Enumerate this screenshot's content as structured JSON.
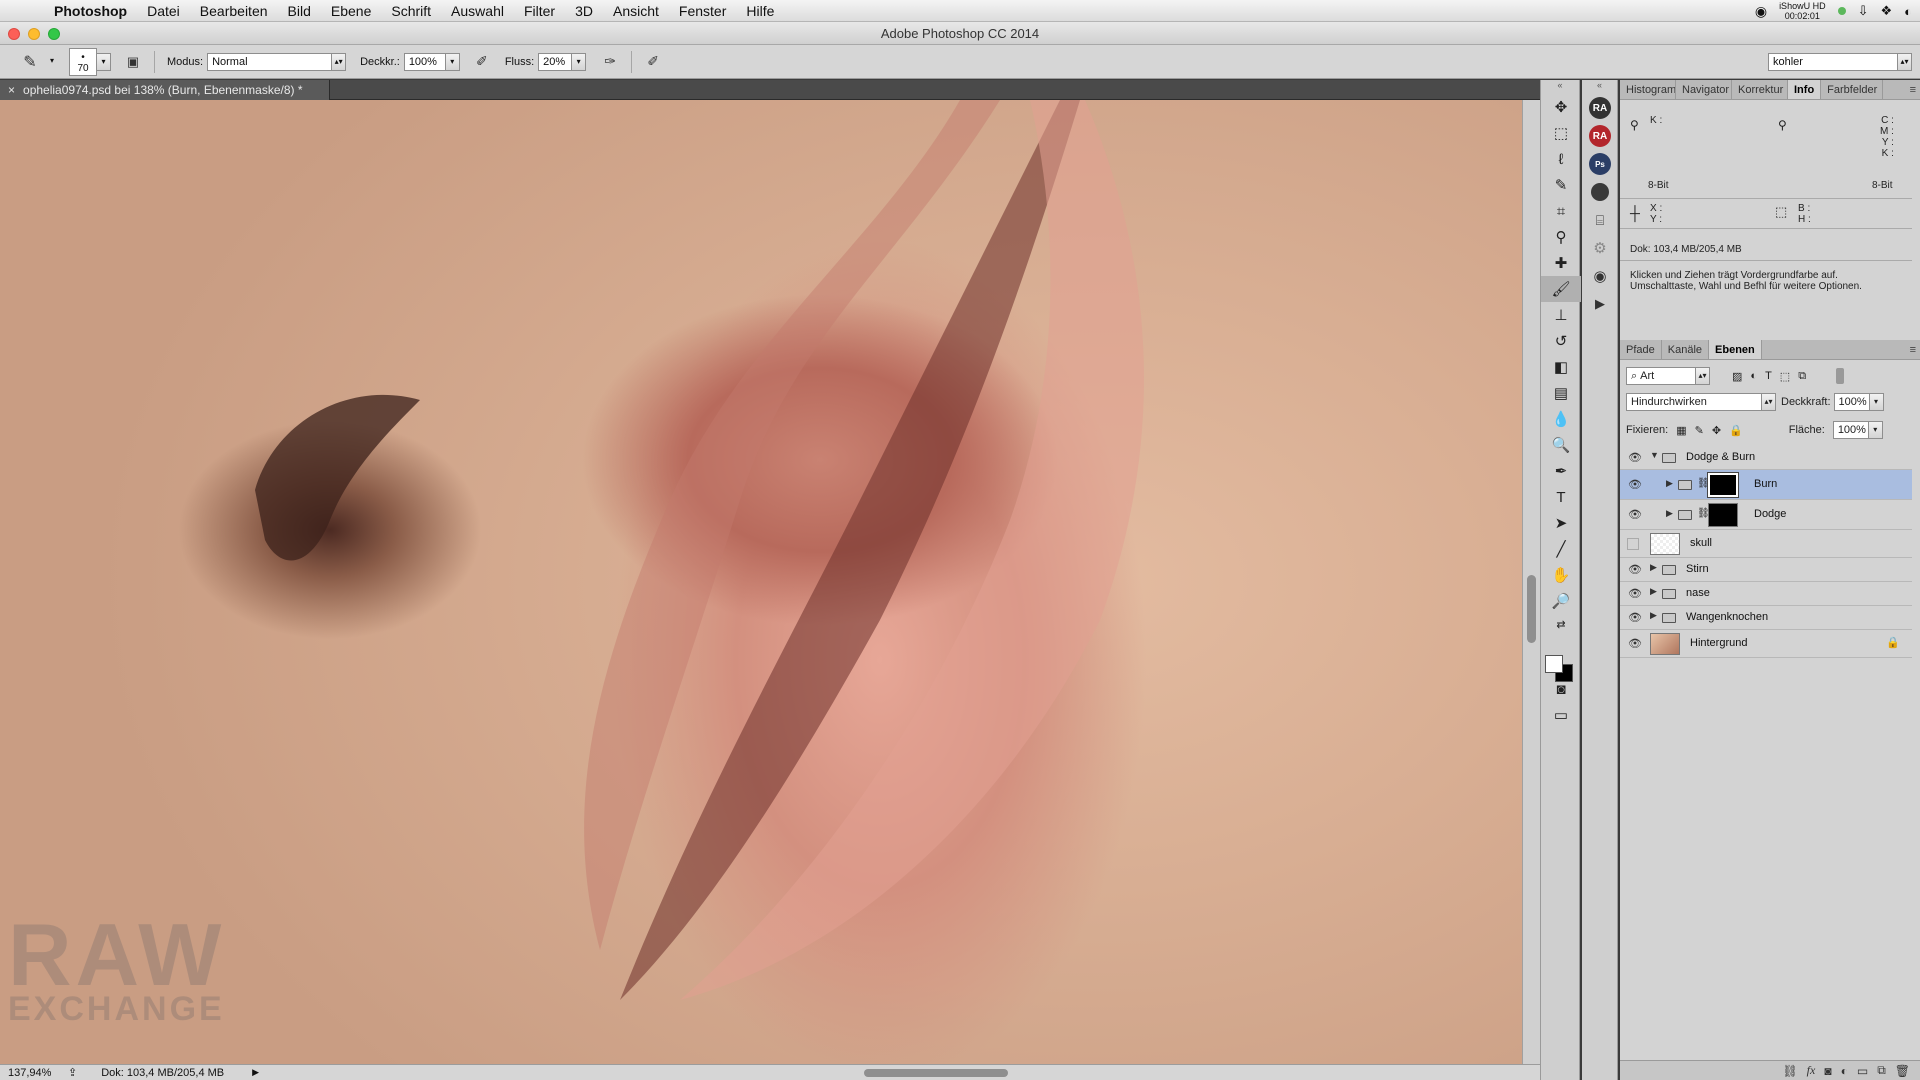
{
  "menubar": {
    "app": "Photoshop",
    "items": [
      "Datei",
      "Bearbeiten",
      "Bild",
      "Ebene",
      "Schrift",
      "Auswahl",
      "Filter",
      "3D",
      "Ansicht",
      "Fenster",
      "Hilfe"
    ],
    "recorder_line1": "iShowU HD",
    "recorder_line2": "00:02:01"
  },
  "window": {
    "title": "Adobe Photoshop CC 2014"
  },
  "options": {
    "brush_size": "70",
    "mode_label": "Modus:",
    "mode_value": "Normal",
    "opacity_label": "Deckkr.:",
    "opacity_value": "100%",
    "flow_label": "Fluss:",
    "flow_value": "20%",
    "workspace": "kohler"
  },
  "document": {
    "tab_label": "ophelia0974.psd bei 138% (Burn, Ebenenmaske/8) *",
    "close": "×",
    "watermark_line1": "RAW",
    "watermark_line2": "EXCHANGE"
  },
  "status": {
    "zoom": "137,94%",
    "doc": "Dok: 103,4 MB/205,4 MB"
  },
  "info_panel": {
    "tabs": [
      "Histogram",
      "Navigator",
      "Korrektur",
      "Info",
      "Farbfelder"
    ],
    "active_tab": "Info",
    "k_label": "K :",
    "cmyk_labels": "C :\nM :\nY :\nK :",
    "bit_left": "8-Bit",
    "bit_right": "8-Bit",
    "xy_labels": "X :\nY :",
    "bh_labels": "B :\nH :",
    "doc_size": "Dok: 103,4 MB/205,4 MB",
    "hint": "Klicken und Ziehen trägt Vordergrundfarbe auf. Umschalttaste, Wahl und Befhl für weitere Optionen."
  },
  "layers_panel": {
    "tabs": [
      "Pfade",
      "Kanäle",
      "Ebenen"
    ],
    "active_tab": "Ebenen",
    "filter": "Art",
    "blend_mode": "Hindurchwirken",
    "opacity_label": "Deckkraft:",
    "opacity_value": "100%",
    "lock_label": "Fixieren:",
    "fill_label": "Fläche:",
    "fill_value": "100%",
    "layers": [
      {
        "name": "Dodge & Burn",
        "type": "group",
        "visible": true,
        "expanded": true
      },
      {
        "name": "Burn",
        "type": "group-mask",
        "visible": true,
        "selected": true
      },
      {
        "name": "Dodge",
        "type": "group-mask",
        "visible": true
      },
      {
        "name": "skull",
        "type": "layer",
        "visible": false
      },
      {
        "name": "Stirn",
        "type": "group",
        "visible": true
      },
      {
        "name": "nase",
        "type": "group",
        "visible": true
      },
      {
        "name": "Wangenknochen",
        "type": "group",
        "visible": true
      },
      {
        "name": "Hintergrund",
        "type": "background",
        "visible": true,
        "locked": true
      }
    ]
  },
  "colors": {
    "selection": "#a9bde0",
    "panel": "#d3d3d3",
    "ra_red": "#b3262c",
    "ra_dark": "#333333"
  }
}
